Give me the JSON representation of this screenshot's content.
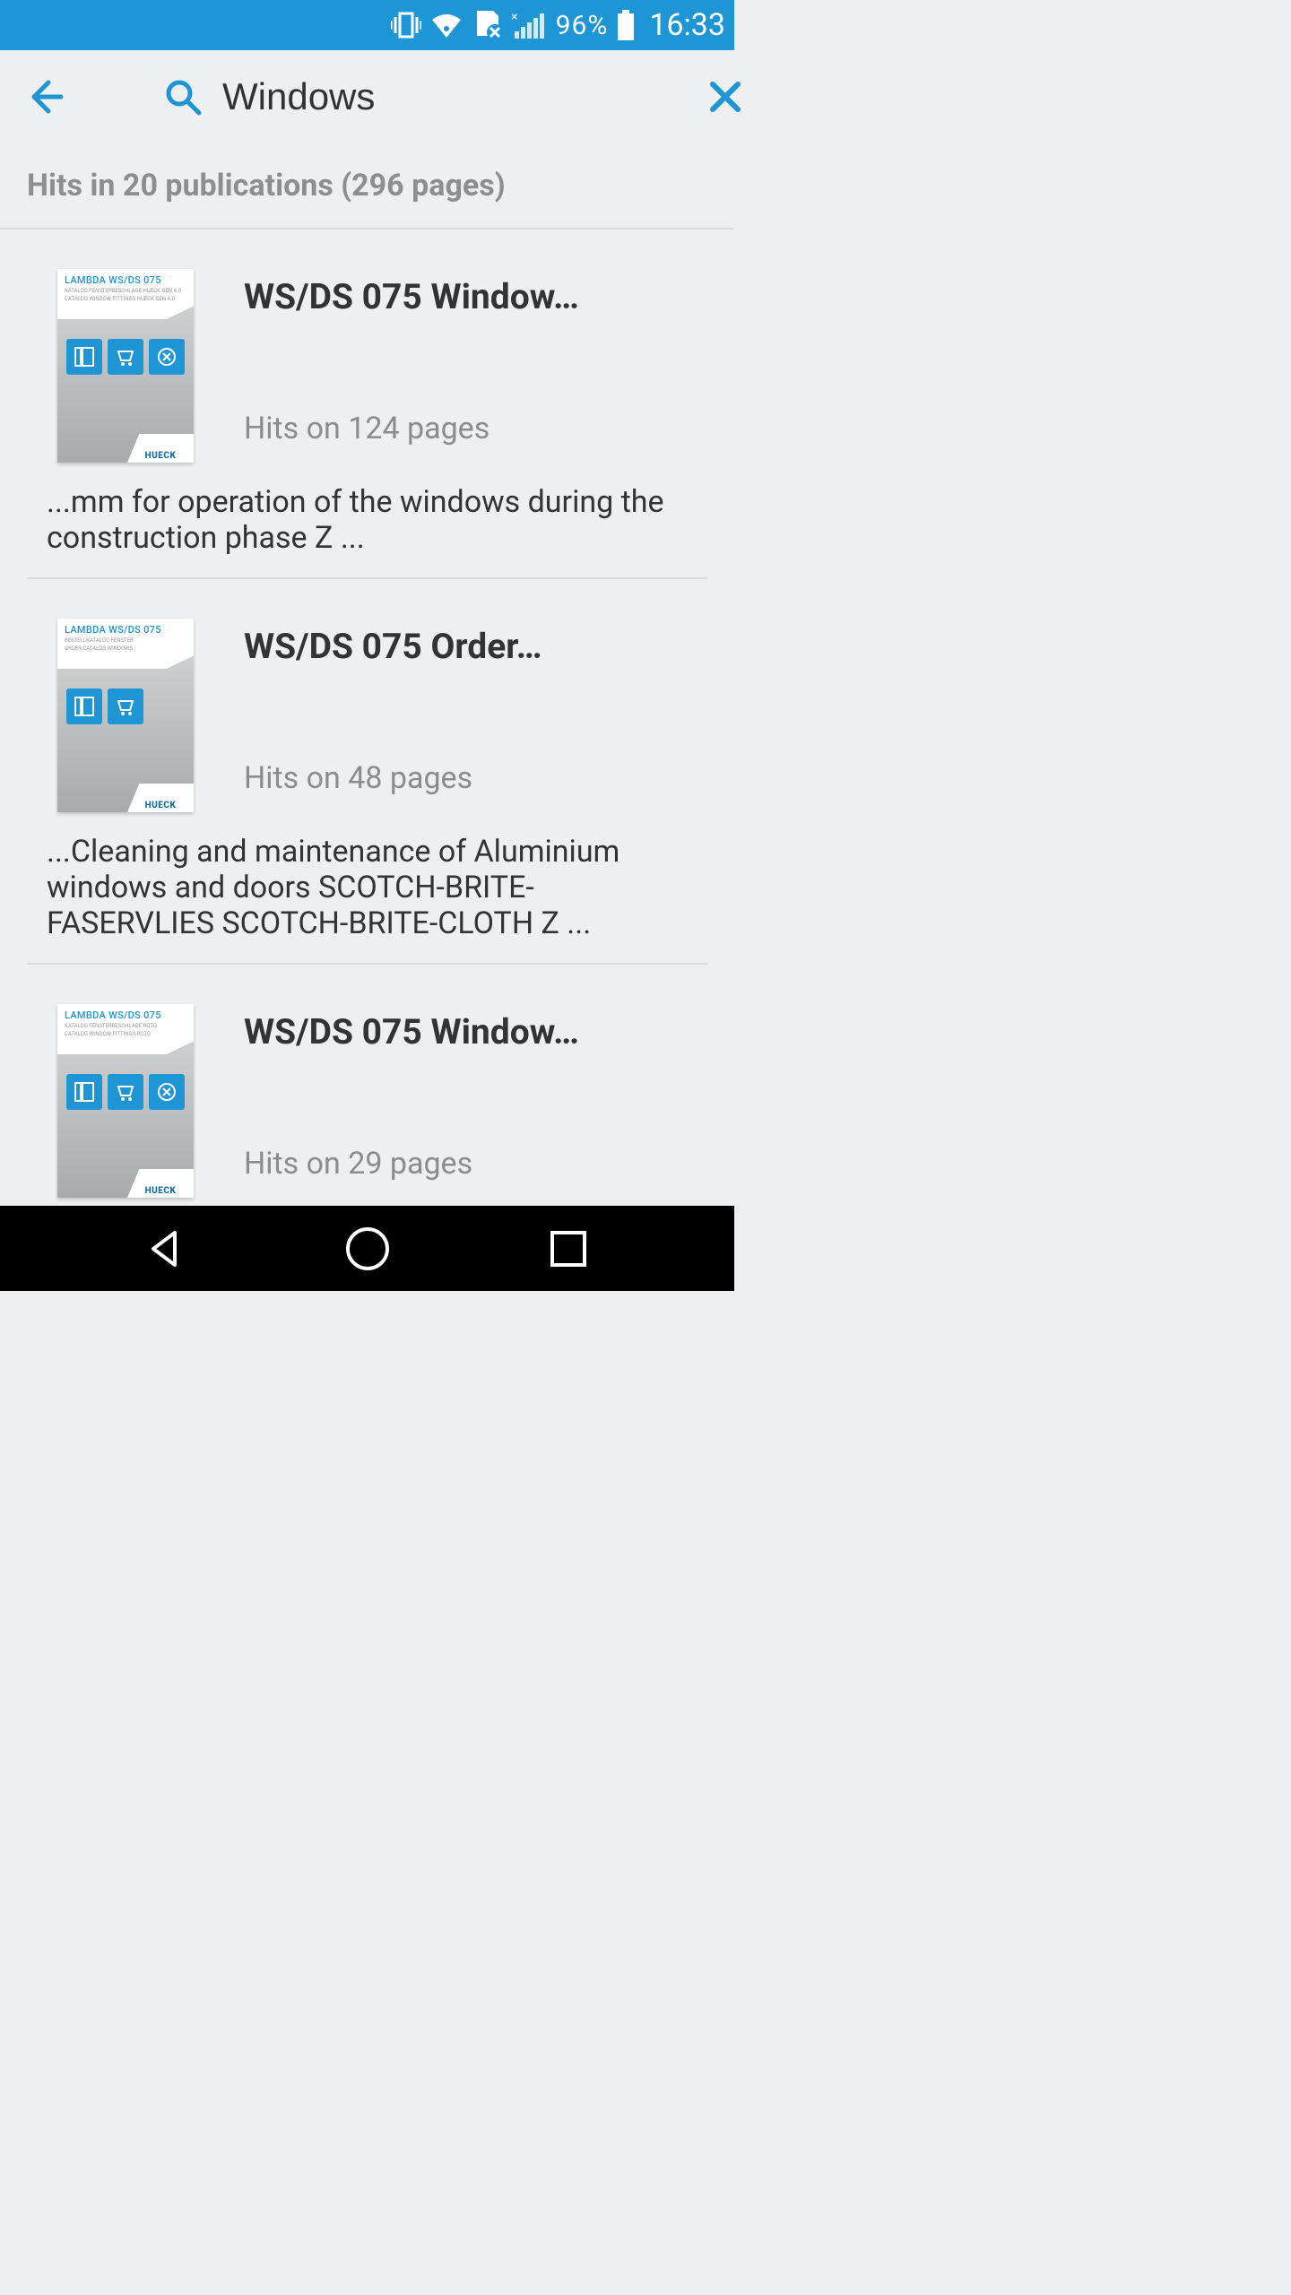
{
  "status": {
    "battery_percent": "96%",
    "time": "16:33"
  },
  "appbar": {
    "search_value": "Windows"
  },
  "summary": "Hits in 20 publications (296 pages)",
  "brand": "HUECK",
  "results": [
    {
      "thumb_title": "LAMBDA WS/DS 075",
      "thumb_sub1": "KATALOG FENSTERBESCHLÄGE HUECK GEN 4.0",
      "thumb_sub2": "CATALOG WINDOW FITTINGS HUECK GEN 4.0",
      "icons": 3,
      "title": "WS/DS 075 Window…",
      "hits": "Hits on 124 pages",
      "snippet": "...mm for operation of the windows during the construction phase Z ..."
    },
    {
      "thumb_title": "LAMBDA WS/DS 075",
      "thumb_sub1": "BESTELLKATALOG FENSTER",
      "thumb_sub2": "ORDER CATALOG WINDOWS",
      "icons": 2,
      "title": "WS/DS 075 Order…",
      "hits": "Hits on 48 pages",
      "snippet": "...Cleaning and maintenance of Aluminium windows and doors SCOTCH-BRITE-FASERVLIES SCOTCH-BRITE-CLOTH Z ..."
    },
    {
      "thumb_title": "LAMBDA WS/DS 075",
      "thumb_sub1": "KATALOG FENSTERBESCHLÄGE ROTO",
      "thumb_sub2": "CATALOG WINDOW FITTINGS ROTO",
      "icons": 3,
      "title": "WS/DS 075 Window…",
      "hits": "Hits on 29 pages",
      "snippet": ""
    }
  ]
}
